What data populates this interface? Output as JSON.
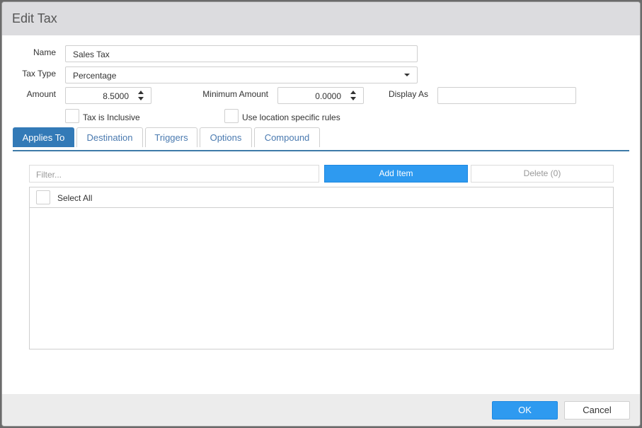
{
  "dialog": {
    "title": "Edit Tax"
  },
  "form": {
    "name_label": "Name",
    "name_value": "Sales Tax",
    "tax_type_label": "Tax Type",
    "tax_type_value": "Percentage",
    "amount_label": "Amount",
    "amount_value": "8.5000",
    "minimum_amount_label": "Minimum Amount",
    "minimum_amount_value": "0.0000",
    "display_as_label": "Display As",
    "display_as_value": "",
    "tax_inclusive_label": "Tax is Inclusive",
    "tax_inclusive_checked": false,
    "location_rules_label": "Use location specific rules",
    "location_rules_checked": false
  },
  "tabs": [
    {
      "label": "Applies To",
      "active": true
    },
    {
      "label": "Destination",
      "active": false
    },
    {
      "label": "Triggers",
      "active": false
    },
    {
      "label": "Options",
      "active": false
    },
    {
      "label": "Compound",
      "active": false
    }
  ],
  "applies_to": {
    "filter_placeholder": "Filter...",
    "add_item_label": "Add Item",
    "delete_label": "Delete (0)",
    "select_all_label": "Select All"
  },
  "footer": {
    "ok_label": "OK",
    "cancel_label": "Cancel"
  },
  "colors": {
    "accent": "#2e9af0",
    "tab_active": "#337ab7",
    "titlebar": "#dcdcdf"
  }
}
